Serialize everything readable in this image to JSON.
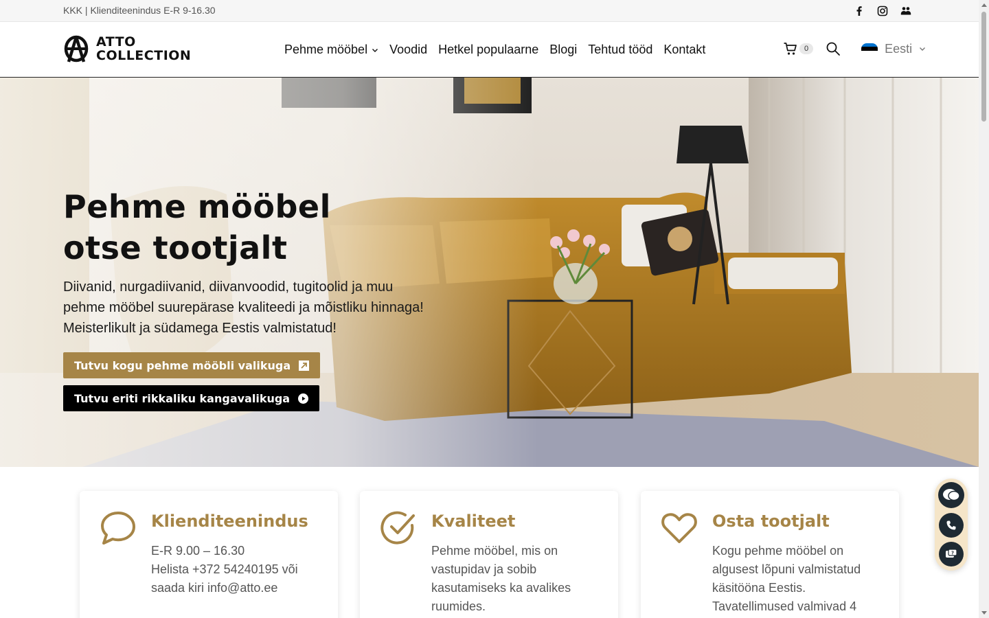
{
  "topbar": {
    "faq": "KKK",
    "separator": "|",
    "hours": "Klienditeenindus E-R 9-16.30",
    "social": [
      "facebook-icon",
      "instagram-icon",
      "community-icon"
    ]
  },
  "header": {
    "logo_line1": "ATTO",
    "logo_line2": "COLLECTION",
    "nav": [
      {
        "label": "Pehme mööbel",
        "dropdown": true
      },
      {
        "label": "Voodid"
      },
      {
        "label": "Hetkel populaarne"
      },
      {
        "label": "Blogi"
      },
      {
        "label": "Tehtud tööd"
      },
      {
        "label": "Kontakt"
      }
    ],
    "cart_count": "0",
    "language": "Eesti"
  },
  "hero": {
    "title_line1": "Pehme mööbel",
    "title_line2": "otse tootjalt",
    "text_line1": "Diivanid, nurgadiivanid, diivanvoodid, tugitoolid ja muu",
    "text_line2": "pehme mööbel suurepärase kvaliteedi ja mõistliku hinnaga!",
    "text_line3": "Meisterlikult ja südamega Eestis valmistatud!",
    "btn_primary": "Tutvu kogu pehme mööbli valikuga",
    "btn_secondary": "Tutvu eriti rikkaliku kangavalikuga"
  },
  "features": [
    {
      "title": "Klienditeenindus",
      "lines": [
        "E-R 9.00 – 16.30",
        "Helista +372 54240195 või",
        "saada kiri info@atto.ee"
      ]
    },
    {
      "title": "Kvaliteet",
      "lines": [
        "Pehme mööbel, mis on",
        "vastupidav ja sobib",
        "kasutamiseks ka avalikes",
        "ruumides."
      ]
    },
    {
      "title": "Osta tootjalt",
      "lines": [
        "Kogu pehme mööbel on",
        "algusest lõpuni valmistatud",
        "käsitööna Eestis.",
        "Tavatellimused valmivad 4"
      ]
    }
  ],
  "colors": {
    "accent": "#a68547",
    "dark": "#000000",
    "widget_bg": "#f5e5c8"
  }
}
